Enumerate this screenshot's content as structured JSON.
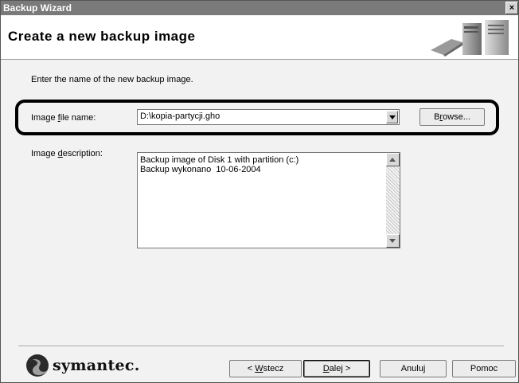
{
  "window": {
    "title": "Backup Wizard",
    "close_glyph": "×"
  },
  "header": {
    "title": "Create a new backup image",
    "art_icon": "computer-hardware-icon"
  },
  "instruction": "Enter the name of the new backup image.",
  "image_file": {
    "label_pre": "Image ",
    "label_accel": "f",
    "label_post": "ile name:",
    "value": "D:\\kopia-partycji.gho",
    "browse_pre": "B",
    "browse_accel": "r",
    "browse_post": "owse..."
  },
  "image_description": {
    "label_pre": "Image ",
    "label_accel": "d",
    "label_post": "escription:",
    "value": "Backup image of Disk 1 with partition (c:)\nBackup wykonano  10-06-2004"
  },
  "footer": {
    "logo_text": "symantec.",
    "back": {
      "pre": "< ",
      "accel": "W",
      "post": "stecz"
    },
    "next": {
      "pre": "",
      "accel": "D",
      "post": "alej >"
    },
    "cancel_label": "Anuluj",
    "help_label": "Pomoc"
  },
  "colors": {
    "titlebar": "#7a7a7a",
    "background": "#f2f2f2",
    "highlight_border": "#000000"
  }
}
